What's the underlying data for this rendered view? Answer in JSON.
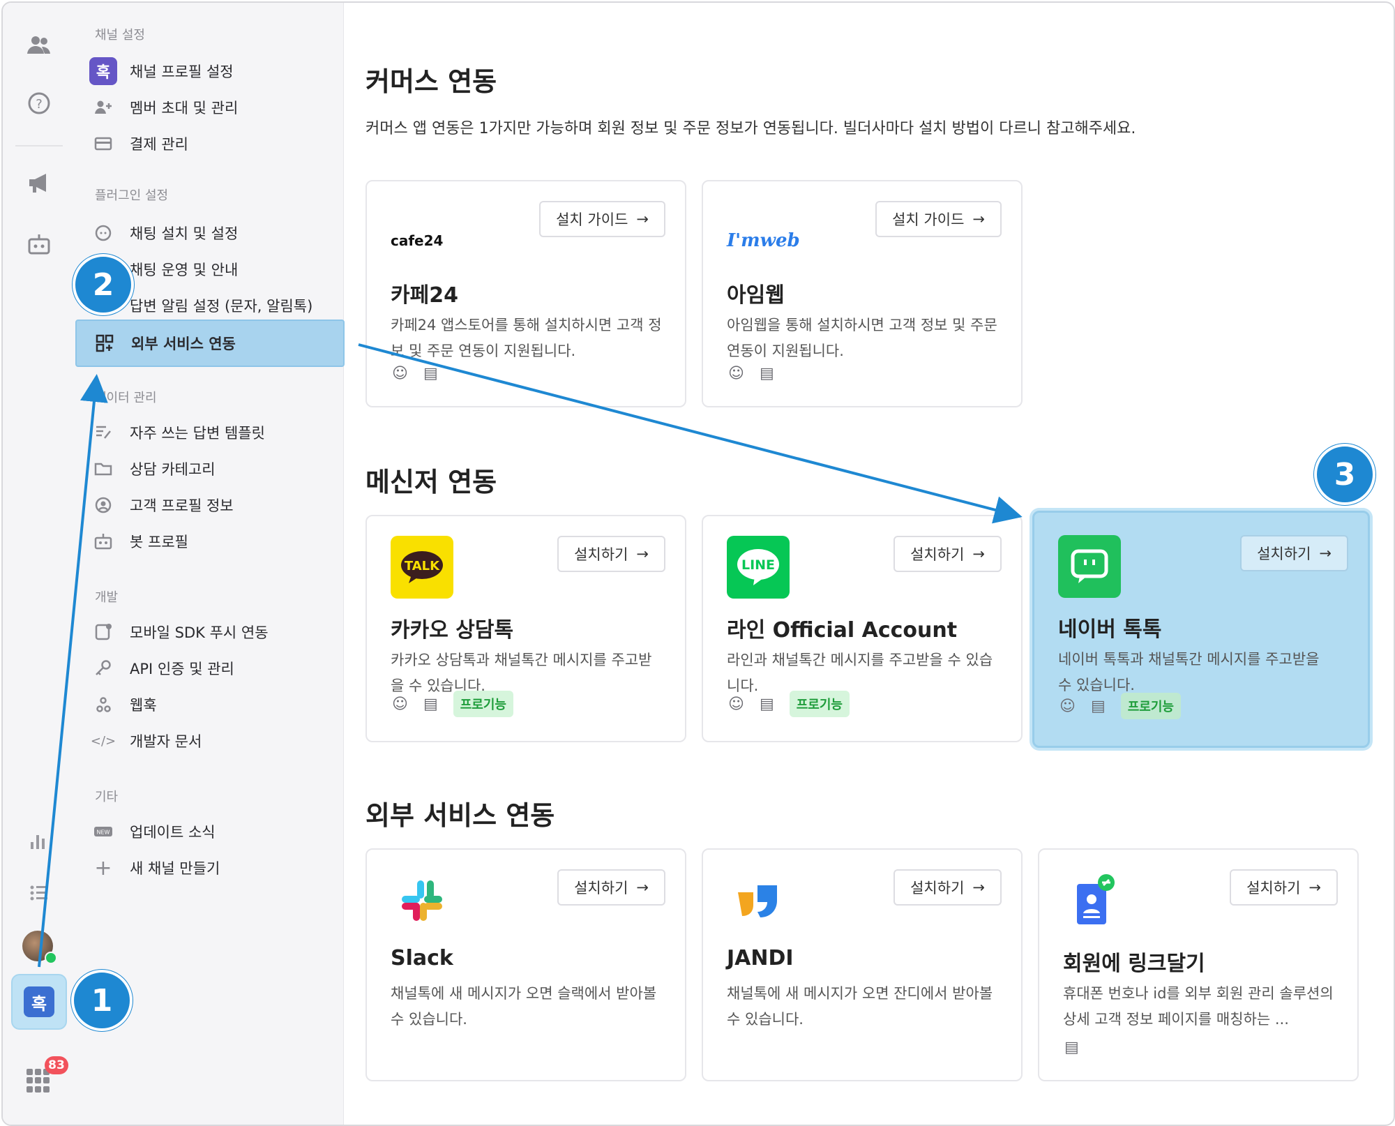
{
  "rail": {
    "icons": [
      "people-icon",
      "help-icon",
      "megaphone-icon",
      "bot-icon",
      "stats-icon",
      "list-icon"
    ],
    "channel_initial": "혹",
    "apps_badge": "83"
  },
  "sidebar": {
    "sections": {
      "channel": "채널 설정",
      "plugin": "플러그인 설정",
      "data": "데이터 관리",
      "dev": "개발",
      "etc": "기타"
    },
    "profile_icon_text": "혹",
    "items": {
      "channel_profile": "채널 프로필 설정",
      "members": "멤버 초대 및 관리",
      "billing": "결제 관리",
      "chat_setup": "채팅 설치 및 설정",
      "chat_ops": "채팅 운영 및 안내",
      "reply_alert": "답변 알림 설정 (문자, 알림톡)",
      "external": "외부 서비스 연동",
      "templates": "자주 쓰는 답변 템플릿",
      "categories": "상담 카테고리",
      "customer_profile": "고객 프로필 정보",
      "bot_profile": "봇 프로필",
      "mobile_sdk": "모바일 SDK 푸시 연동",
      "api": "API 인증 및 관리",
      "webhook": "웹훅",
      "dev_docs": "개발자 문서",
      "updates": "업데이트 소식",
      "new_channel": "새 채널 만들기"
    }
  },
  "main": {
    "commerce": {
      "heading": "커머스 연동",
      "description": "커머스 앱 연동은 1가지만 가능하며 회원 정보 및 주문 정보가 연동됩니다. 빌더사마다 설치 방법이 다르니 참고해주세요.",
      "cards": [
        {
          "logo_text": "cafe24",
          "button": "설치 가이드",
          "title": "카페24",
          "desc": "카페24 앱스토어를 통해 설치하시면 고객 정보 및 주문 연동이 지원됩니다."
        },
        {
          "logo_text": "I'mweb",
          "button": "설치 가이드",
          "title": "아임웹",
          "desc": "아임웹을 통해 설치하시면 고객 정보 및 주문 연동이 지원됩니다."
        }
      ]
    },
    "messenger": {
      "heading": "메신저 연동",
      "cards": [
        {
          "logo_text": "TALK",
          "button": "설치하기",
          "title": "카카오 상담톡",
          "desc": "카카오 상담톡과 채널톡간 메시지를 주고받을 수 있습니다.",
          "badge": "프로기능"
        },
        {
          "logo_text": "LINE",
          "button": "설치하기",
          "title": "라인 Official Account",
          "desc": "라인과 채널톡간 메시지를 주고받을 수 있습니다.",
          "badge": "프로기능"
        },
        {
          "button": "설치하기",
          "title": "네이버 톡톡",
          "desc": "네이버 톡톡과 채널톡간 메시지를 주고받을 수 있습니다.",
          "badge": "프로기능"
        }
      ]
    },
    "external": {
      "heading": "외부 서비스 연동",
      "cards": [
        {
          "button": "설치하기",
          "title": "Slack",
          "desc": "채널톡에 새 메시지가 오면 슬랙에서 받아볼 수 있습니다."
        },
        {
          "button": "설치하기",
          "title": "JANDI",
          "desc": "채널톡에 새 메시지가 오면 잔디에서 받아볼 수 있습니다."
        },
        {
          "button": "설치하기",
          "title": "회원에 링크달기",
          "desc": "휴대폰 번호나 id를 외부 회원 관리 솔루션의 상세 고객 정보 페이지를 매칭하는 ..."
        }
      ]
    }
  },
  "annotations": {
    "step1": "1",
    "step2": "2",
    "step3": "3"
  },
  "colors": {
    "accent": "#1e88d2",
    "highlight": "#a8d3ee",
    "pro_green": "#1f9d3b",
    "kakao": "#f9e000",
    "line": "#06c755",
    "naver": "#20c05c"
  }
}
